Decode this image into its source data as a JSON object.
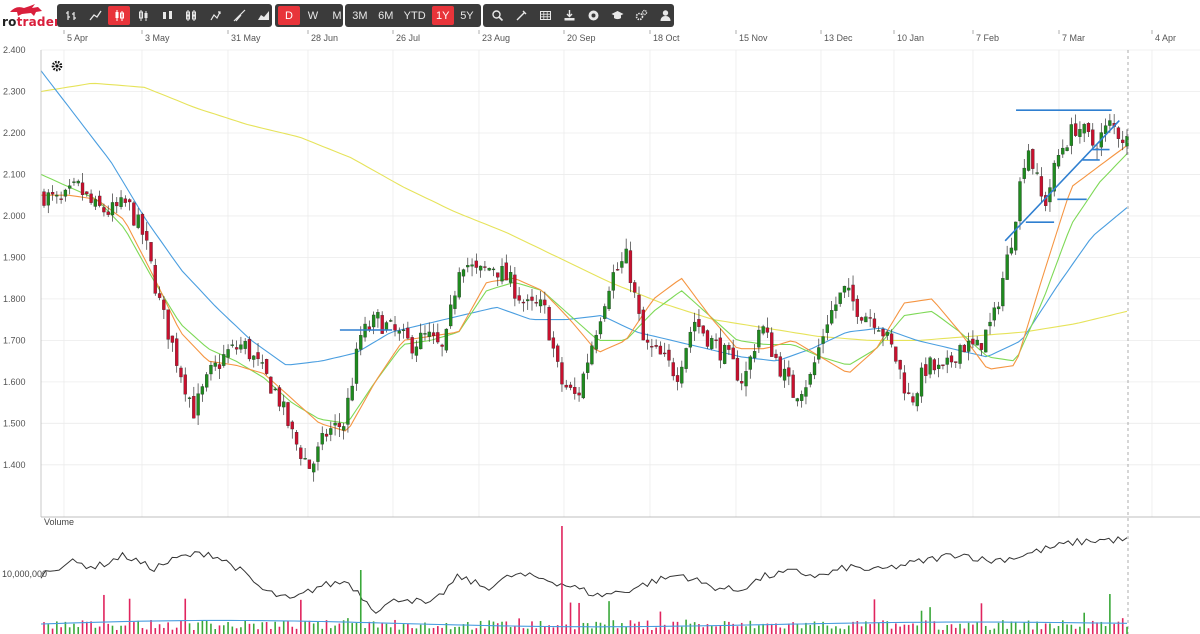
{
  "brand": {
    "name_part1": "ro",
    "name_part2": "trader"
  },
  "toolbar": {
    "chart_types": [
      "ohlc-bars-icon",
      "line-chart-icon",
      "candlestick-icon",
      "hollow-candle-icon",
      "heikin-ashi-icon",
      "volume-candle-icon",
      "renko-icon",
      "point-figure-icon",
      "mountain-icon"
    ],
    "active_chart_type": "candlestick-icon",
    "intervals": [
      "D",
      "W",
      "M"
    ],
    "active_interval": "D",
    "ranges": [
      "3M",
      "6M",
      "YTD",
      "1Y",
      "5Y"
    ],
    "active_range": "1Y",
    "tools": [
      "search-icon",
      "drawing-tool-icon",
      "table-icon",
      "download-icon",
      "record-icon",
      "graduation-cap-icon",
      "settings-cogs-icon",
      "user-icon"
    ]
  },
  "colors": {
    "up": "#1f8a1f",
    "down": "#c8102e",
    "ema_fast": "#f59542",
    "ema_mid": "#7ed957",
    "sma_long": "#4a9ee0",
    "sma_200": "#e6e35a",
    "trendline": "#2f7fd0",
    "accent": "#e8343a"
  },
  "chart_data": {
    "type": "candlestick",
    "x_ticks": [
      "5 Apr",
      "3 May",
      "31 May",
      "28 Jun",
      "26 Jul",
      "23 Aug",
      "20 Sep",
      "18 Oct",
      "15 Nov",
      "13 Dec",
      "10 Jan",
      "7 Feb",
      "7 Mar",
      "4 Apr"
    ],
    "y_ticks": [
      "2.400",
      "2.300",
      "2.200",
      "2.100",
      "2.000",
      "1.900",
      "1.800",
      "1.700",
      "1.600",
      "1.500",
      "1.400"
    ],
    "ylim": [
      1.32,
      2.4
    ],
    "close_anchors": [
      2.05,
      2.03,
      2.07,
      2.02,
      2.01,
      2.03,
      1.95,
      1.78,
      1.65,
      1.53,
      1.62,
      1.67,
      1.69,
      1.63,
      1.57,
      1.46,
      1.39,
      1.48,
      1.5,
      1.71,
      1.75,
      1.72,
      1.69,
      1.71,
      1.67,
      1.9,
      1.86,
      1.88,
      1.84,
      1.78,
      1.78,
      1.6,
      1.56,
      1.71,
      1.85,
      1.9,
      1.69,
      1.66,
      1.62,
      1.75,
      1.7,
      1.66,
      1.6,
      1.74,
      1.65,
      1.57,
      1.61,
      1.75,
      1.82,
      1.77,
      1.75,
      1.67,
      1.55,
      1.64,
      1.62,
      1.69,
      1.68,
      1.75,
      1.93,
      2.18,
      2.02,
      2.16,
      2.22,
      2.17,
      2.22,
      2.18
    ],
    "ema_fast_anchors": [
      2.05,
      2.05,
      2.04,
      1.99,
      1.86,
      1.72,
      1.65,
      1.64,
      1.62,
      1.56,
      1.5,
      1.48,
      1.6,
      1.7,
      1.71,
      1.72,
      1.84,
      1.85,
      1.82,
      1.75,
      1.67,
      1.7,
      1.8,
      1.85,
      1.76,
      1.68,
      1.68,
      1.7,
      1.66,
      1.62,
      1.68,
      1.79,
      1.8,
      1.72,
      1.63,
      1.64,
      1.86,
      2.07,
      2.12,
      2.17
    ],
    "ema_mid_anchors": [
      2.1,
      2.07,
      2.04,
      1.97,
      1.85,
      1.74,
      1.68,
      1.65,
      1.61,
      1.55,
      1.51,
      1.5,
      1.6,
      1.69,
      1.7,
      1.72,
      1.82,
      1.84,
      1.82,
      1.76,
      1.7,
      1.7,
      1.77,
      1.82,
      1.76,
      1.7,
      1.69,
      1.69,
      1.66,
      1.64,
      1.68,
      1.76,
      1.77,
      1.72,
      1.66,
      1.65,
      1.8,
      1.98,
      2.08,
      2.15
    ],
    "sma_long_anchors": [
      2.35,
      2.24,
      2.13,
      1.99,
      1.87,
      1.78,
      1.7,
      1.64,
      1.65,
      1.67,
      1.72,
      1.74,
      1.76,
      1.78,
      1.75,
      1.75,
      1.76,
      1.72,
      1.7,
      1.68,
      1.66,
      1.65,
      1.68,
      1.72,
      1.73,
      1.7,
      1.68,
      1.66,
      1.7,
      1.83,
      1.95,
      2.02
    ],
    "sma_200_anchors": [
      2.3,
      2.32,
      2.31,
      2.26,
      2.22,
      2.19,
      2.14,
      2.07,
      2.01,
      1.96,
      1.9,
      1.84,
      1.79,
      1.75,
      1.73,
      1.71,
      1.7,
      1.7,
      1.71,
      1.72,
      1.74,
      1.77
    ],
    "annotations": {
      "resistance": {
        "x1": 0.897,
        "x2": 0.985,
        "y": 2.255
      },
      "rising_trendline": {
        "x1": 0.887,
        "y1": 1.94,
        "x2": 0.992,
        "y2": 2.23
      },
      "small_levels": [
        {
          "x1": 0.275,
          "x2": 0.323,
          "y": 1.725
        },
        {
          "x1": 0.906,
          "x2": 0.932,
          "y": 1.985
        },
        {
          "x1": 0.935,
          "x2": 0.962,
          "y": 2.04
        },
        {
          "x1": 0.958,
          "x2": 0.974,
          "y": 2.135
        },
        {
          "x1": 0.967,
          "x2": 0.983,
          "y": 2.16
        }
      ]
    },
    "volume": {
      "label": "Volume",
      "tick_label": "10,000,000",
      "line_anchors": [
        0.62,
        0.75,
        0.7,
        0.82,
        0.68,
        0.8,
        0.85,
        0.7,
        0.45,
        0.35,
        0.5,
        0.55,
        0.25,
        0.38,
        0.3,
        0.6,
        0.48,
        0.62,
        0.58,
        0.5,
        0.4,
        0.45,
        0.55,
        0.62,
        0.5,
        0.45,
        0.6,
        0.65,
        0.6,
        0.7,
        0.66,
        0.72,
        0.78,
        0.84,
        0.76,
        0.8,
        0.88,
        0.95,
        0.98,
        0.98
      ]
    }
  }
}
